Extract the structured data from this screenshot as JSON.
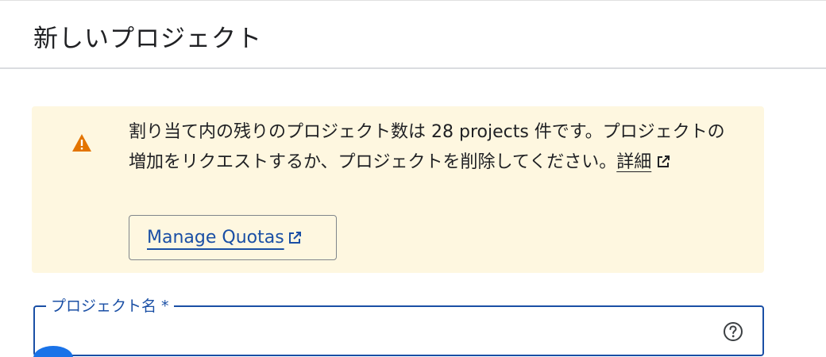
{
  "header": {
    "title": "新しいプロジェクト"
  },
  "alert": {
    "icon": "warning-icon",
    "message": "割り当て内の残りのプロジェクト数は 28 projects 件です。プロジェクトの増加をリクエストするか、プロジェクトを削除してください。",
    "detail_link_label": "詳細",
    "manage_button_label": "Manage Quotas",
    "background_color": "#fef7e0",
    "icon_color": "#e37400"
  },
  "form": {
    "project_name": {
      "label": "プロジェクト名 *",
      "value": ""
    }
  },
  "colors": {
    "accent": "#1a4fa5"
  }
}
